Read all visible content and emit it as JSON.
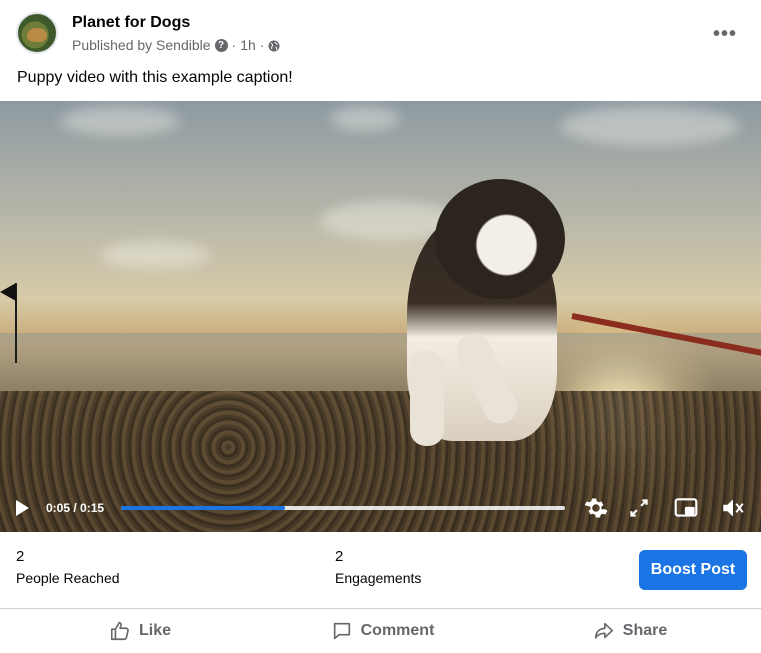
{
  "post": {
    "page_name": "Planet for Dogs",
    "published_by": "Published by Sendible",
    "help_icon": "question-icon",
    "separator": "·",
    "time": "1h",
    "audience_icon": "globe-icon",
    "more_icon": "more-horizontal-icon",
    "more_label": "•••",
    "caption": "Puppy video with this example caption!"
  },
  "video": {
    "current_time": "0:05 / 0:15",
    "progress": 0.37,
    "controls": [
      "play-icon",
      "settings-icon",
      "fullscreen-icon",
      "picture-in-picture-icon",
      "volume-icon"
    ]
  },
  "stats": {
    "reached_count": "2",
    "reached_label": "People Reached",
    "engagements_count": "2",
    "engagements_label": "Engagements",
    "boost_label": "Boost Post"
  },
  "actions": {
    "like": "Like",
    "comment": "Comment",
    "share": "Share"
  },
  "colors": {
    "accent": "#1b74e4",
    "secondary_text": "#65676b"
  }
}
